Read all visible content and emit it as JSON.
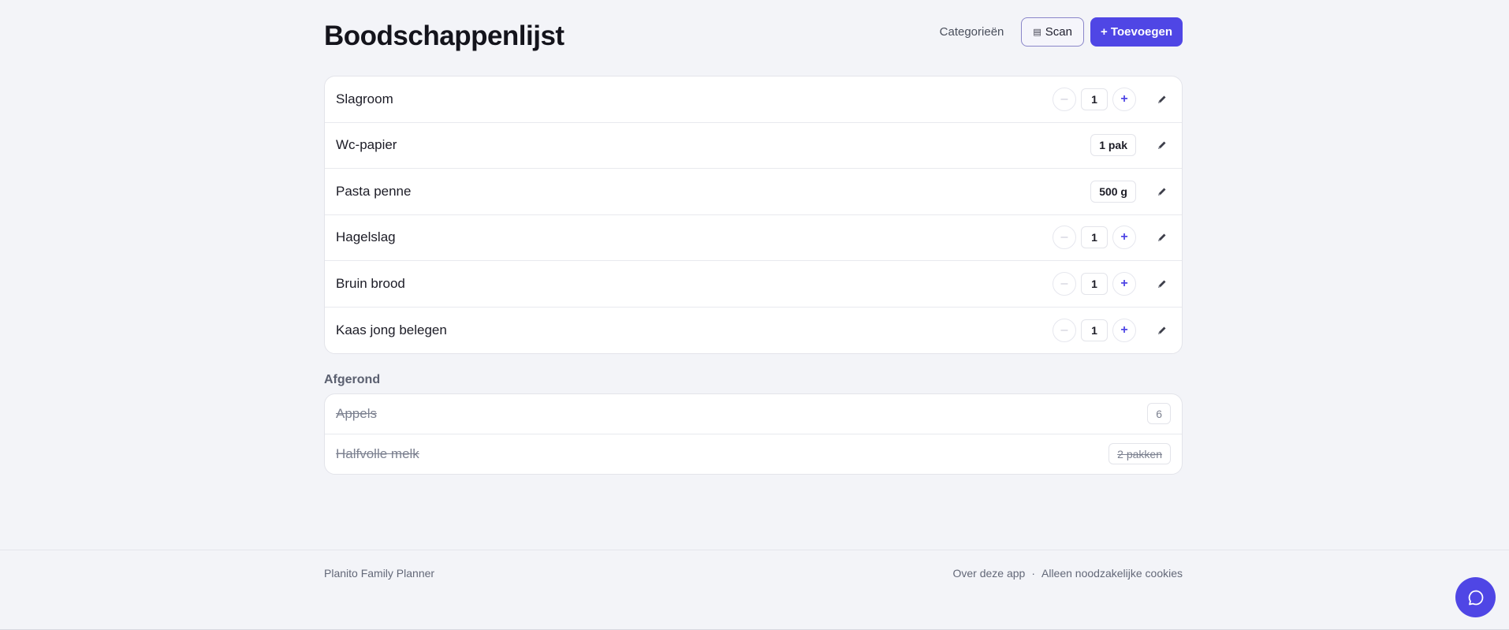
{
  "header": {
    "title": "Boodschappenlijst",
    "categories_label": "Categorieën",
    "scan_label": "Scan",
    "add_label": "+ Toevoegen"
  },
  "items": [
    {
      "name": "Slagroom",
      "quantity": "1",
      "type": "stepper"
    },
    {
      "name": "Wc-papier",
      "quantity": "1 pak",
      "type": "fixed"
    },
    {
      "name": "Pasta penne",
      "quantity": "500 g",
      "type": "fixed"
    },
    {
      "name": "Hagelslag",
      "quantity": "1",
      "type": "stepper"
    },
    {
      "name": "Bruin brood",
      "quantity": "1",
      "type": "stepper"
    },
    {
      "name": "Kaas jong belegen",
      "quantity": "1",
      "type": "stepper"
    }
  ],
  "stepper": {
    "minus": "–",
    "plus": "+"
  },
  "completed": {
    "label": "Afgerond",
    "items": [
      {
        "name": "Appels",
        "quantity": "6"
      },
      {
        "name": "Halfvolle melk",
        "quantity": "2 pakken"
      }
    ]
  },
  "footer": {
    "brand": "Planito Family Planner",
    "link_about": "Over deze app",
    "separator": "·",
    "link_cookies": "Alleen noodzakelijke cookies"
  },
  "icons": {
    "scan": "scan-icon",
    "edit": "pencil-icon",
    "chat": "chat-bubble-icon"
  },
  "colors": {
    "accent": "#4f46e5",
    "background": "#f3f4f8"
  }
}
